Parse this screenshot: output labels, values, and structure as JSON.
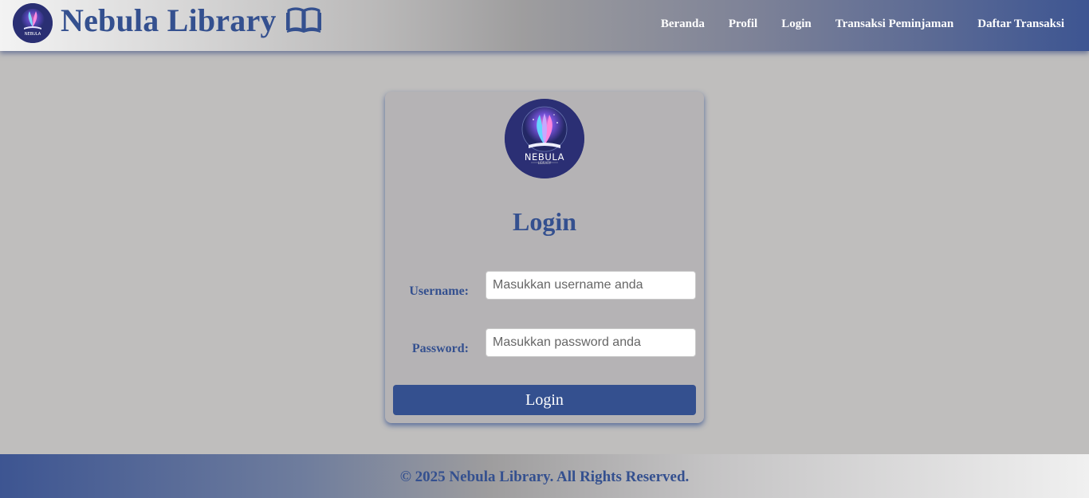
{
  "header": {
    "title": "Nebula Library",
    "book_icon": "open-book-icon",
    "logo_text": "NEBULA",
    "nav": [
      {
        "label": "Beranda"
      },
      {
        "label": "Profil"
      },
      {
        "label": "Login"
      },
      {
        "label": "Transaksi Peminjaman"
      },
      {
        "label": "Daftar Transaksi"
      }
    ]
  },
  "login": {
    "logo_text": "NEBULA",
    "logo_subtext": "LIBRARY",
    "title": "Login",
    "username_label": "Username:",
    "username_placeholder": "Masukkan username anda",
    "password_label": "Password:",
    "password_placeholder": "Masukkan password anda",
    "button_label": "Login"
  },
  "footer": {
    "text": "© 2025 Nebula Library. All Rights Reserved."
  },
  "colors": {
    "brand": "#34508f",
    "background": "#bfbebd",
    "card": "#b5b3b5"
  }
}
